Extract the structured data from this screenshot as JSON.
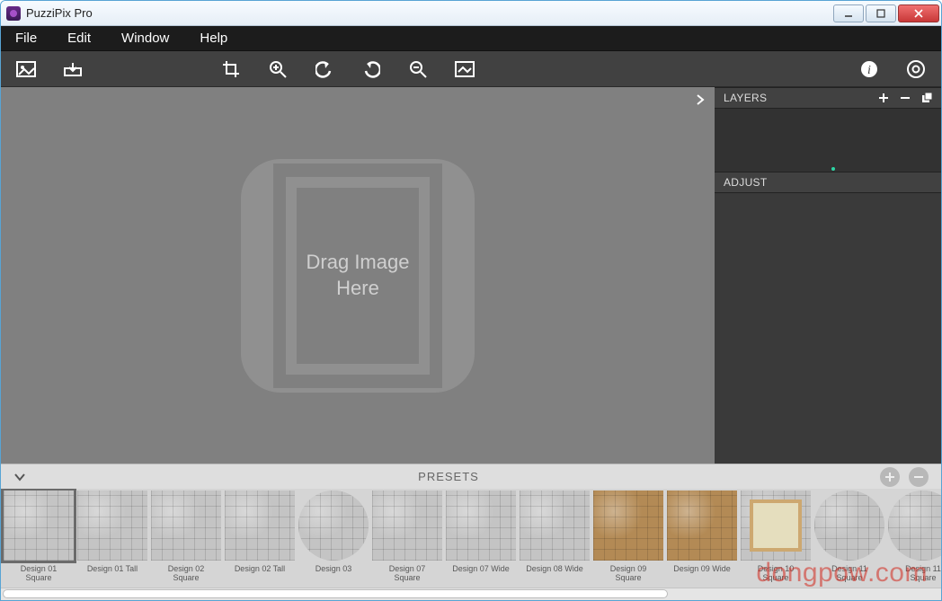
{
  "window": {
    "title": "PuzziPix Pro"
  },
  "menu": {
    "file": "File",
    "edit": "Edit",
    "window": "Window",
    "help": "Help"
  },
  "canvas": {
    "drop_l1": "Drag Image",
    "drop_l2": "Here"
  },
  "panels": {
    "layers_title": "LAYERS",
    "adjust_title": "ADJUST"
  },
  "presets": {
    "title": "PRESETS",
    "items": [
      {
        "label": "Design 01\nSquare",
        "shape": "square",
        "selected": true
      },
      {
        "label": "Design 01 Tall",
        "shape": "square"
      },
      {
        "label": "Design 02\nSquare",
        "shape": "square"
      },
      {
        "label": "Design 02 Tall",
        "shape": "square"
      },
      {
        "label": "Design 03",
        "shape": "circle"
      },
      {
        "label": "Design 07\nSquare",
        "shape": "square"
      },
      {
        "label": "Design 07 Wide",
        "shape": "square"
      },
      {
        "label": "Design 08 Wide",
        "shape": "square"
      },
      {
        "label": "Design 09\nSquare",
        "shape": "square",
        "tint": "brown"
      },
      {
        "label": "Design 09 Wide",
        "shape": "square",
        "tint": "brown"
      },
      {
        "label": "Design 10\nSquare",
        "shape": "square",
        "variant": "frame"
      },
      {
        "label": "Design 11\nSquare",
        "shape": "circle"
      },
      {
        "label": "Design 11\nSquare",
        "shape": "circle"
      }
    ]
  },
  "watermark": "dongpow.com"
}
